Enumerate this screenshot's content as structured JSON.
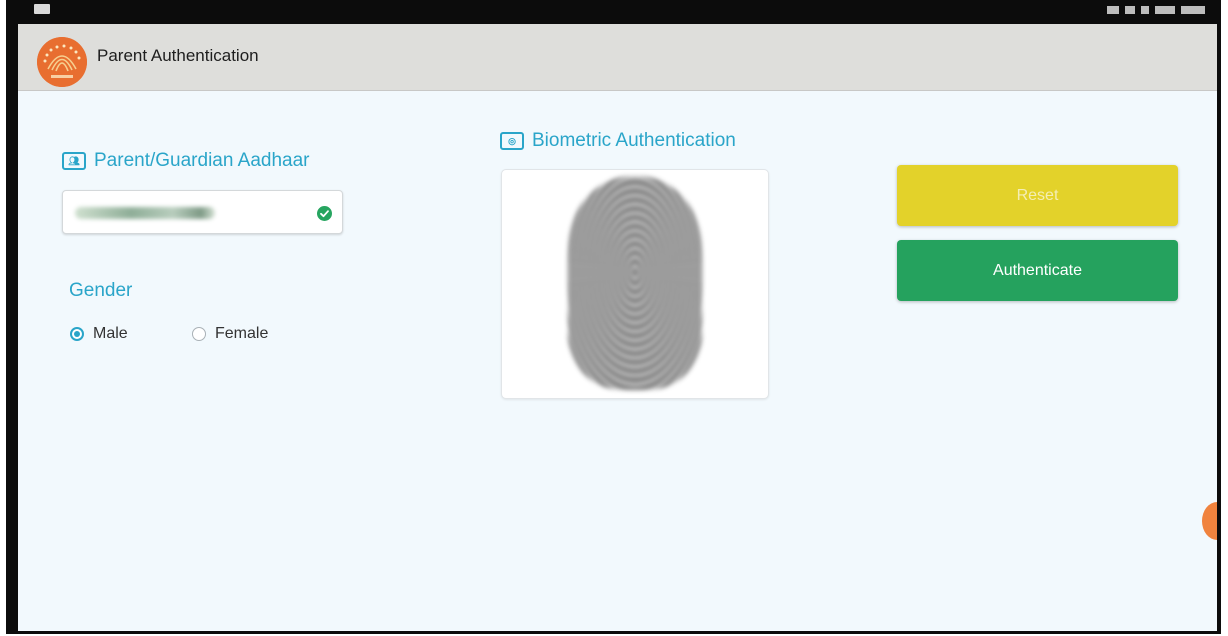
{
  "appbar": {
    "title": "Parent Authentication",
    "logo_icon": "aadhaar-logo-icon"
  },
  "aadhaar_section": {
    "title": "Parent/Guardian Aadhaar",
    "icon": "id-card-icon",
    "field_icon": "check-circle-icon"
  },
  "gender": {
    "label": "Gender",
    "options": [
      "Male",
      "Female"
    ],
    "selected": "Male"
  },
  "biometric": {
    "title": "Biometric Authentication",
    "icon": "fingerprint-icon"
  },
  "actions": {
    "reset_label": "Reset",
    "authenticate_label": "Authenticate"
  },
  "colors": {
    "accent": "#2aa5c9",
    "reset": "#e3d22a",
    "authenticate": "#25a25e",
    "logo": "#e86e30"
  }
}
